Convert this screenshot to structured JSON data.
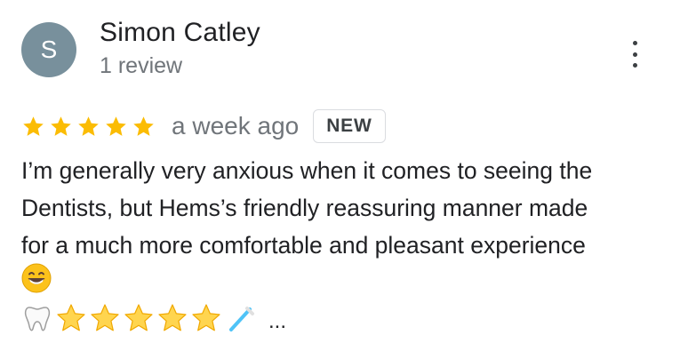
{
  "reviewer": {
    "avatar_initial": "S",
    "avatar_color": "#78909c",
    "name": "Simon Catley",
    "review_count": "1 review"
  },
  "menu": {
    "icon": "more-vert-icon"
  },
  "rating": {
    "stars": 5,
    "max_stars": 5,
    "star_color": "#fbbc04",
    "time": "a week ago",
    "badge": "NEW"
  },
  "review": {
    "lines": [
      "I’m generally very anxious when it comes to seeing the",
      "Dentists, but Hems’s friendly reassuring manner made",
      "for a much more comfortable and pleasant experience"
    ],
    "emoji_grin": "grinning-face-icon",
    "emoji_sequence": [
      "tooth-icon",
      "star-icon",
      "star-icon",
      "star-icon",
      "star-icon",
      "star-icon",
      "toothbrush-icon"
    ],
    "more_label": "..."
  }
}
